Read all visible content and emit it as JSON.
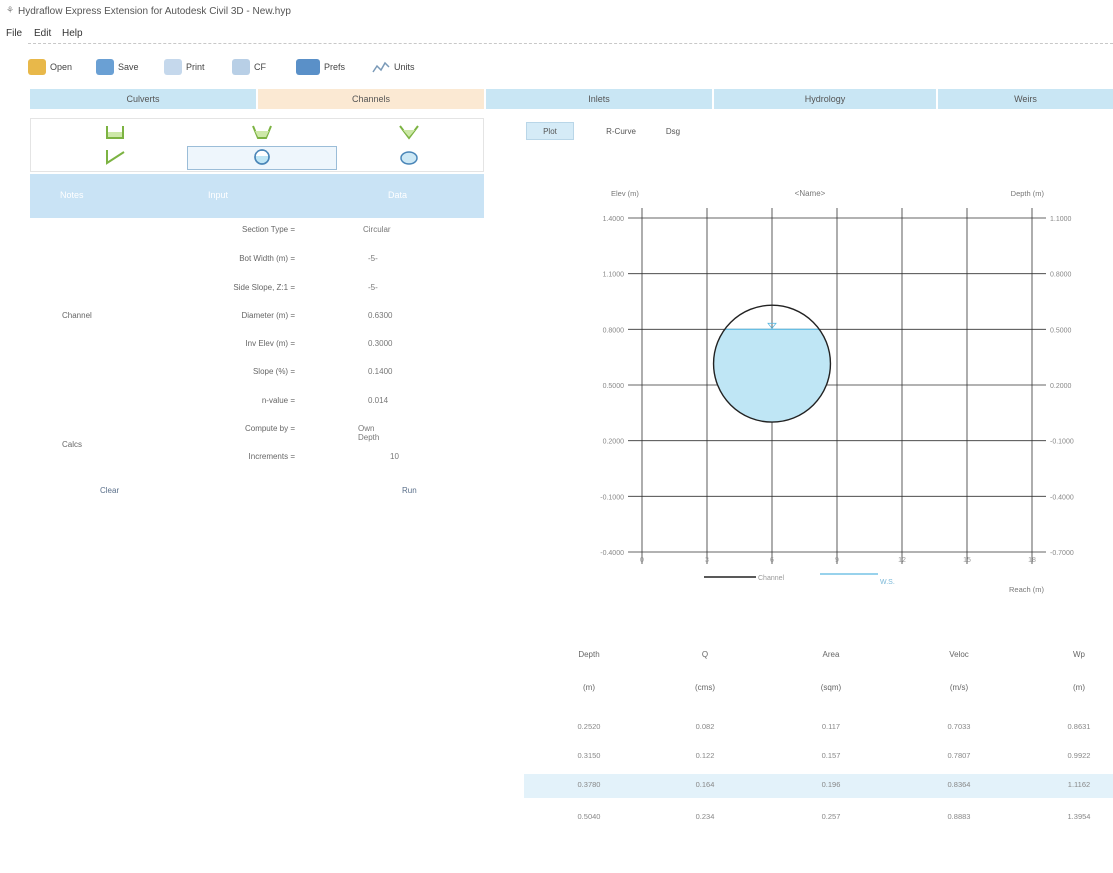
{
  "titlebar": {
    "app_icon": "hydraflow-icon",
    "title": "Hydraflow Express Extension for Autodesk Civil 3D - New.hyp"
  },
  "menu": {
    "items": [
      {
        "label": "File"
      },
      {
        "label": "Edit"
      },
      {
        "label": "Help"
      }
    ]
  },
  "toolbar": {
    "buttons": [
      {
        "label": "Open",
        "icon": "folder-icon",
        "color": "#e8b84a"
      },
      {
        "label": "Save",
        "icon": "save-icon",
        "color": "#6aa0d4"
      },
      {
        "label": "Print",
        "icon": "print-icon",
        "color": "#9ab8d8"
      },
      {
        "label": "CF",
        "icon": "copy-figure-icon",
        "color": "#8fb0d8"
      },
      {
        "label": "Prefs",
        "icon": "prefs-icon",
        "color": "#5a90c8"
      },
      {
        "label": "Units",
        "icon": "units-icon",
        "color": "#7a9ab8"
      }
    ]
  },
  "tabs": [
    {
      "label": "Culverts",
      "active": false
    },
    {
      "label": "Channels",
      "active": true
    },
    {
      "label": "Inlets",
      "active": false
    },
    {
      "label": "Hydrology",
      "active": false
    },
    {
      "label": "Weirs",
      "active": false
    }
  ],
  "channel_types": [
    {
      "icon": "rectangular-channel-icon"
    },
    {
      "icon": "trapezoidal-channel-icon"
    },
    {
      "icon": "triangular-channel-icon"
    },
    {
      "icon": "gutter-channel-icon"
    },
    {
      "icon": "circular-channel-icon",
      "selected": true
    },
    {
      "icon": "elliptical-channel-icon"
    }
  ],
  "left_header": {
    "col1": "Notes",
    "col2": "Input",
    "col3": "Data"
  },
  "inputs": {
    "rows": [
      {
        "label": "Section Type =",
        "value": "Circular"
      },
      {
        "label": "Bot Width (m) =",
        "value": "-5-"
      },
      {
        "label": "Side Slope, Z:1 =",
        "value": "-5-"
      },
      {
        "label": "Diameter (m) =",
        "value": "0.6300"
      },
      {
        "label": "Inv Elev (m) =",
        "value": "0.3000"
      },
      {
        "label": "Slope (%) =",
        "value": "0.1400"
      },
      {
        "label": "n-value =",
        "value": "0.014"
      },
      {
        "label": "Compute by =",
        "value": "Own Depth"
      },
      {
        "label": "Increments =",
        "value": "10"
      }
    ],
    "group_channel": "Channel",
    "group_calcs": "Calcs",
    "clear_label": "Clear",
    "run_label": "Run"
  },
  "right_tabs": [
    {
      "label": "Plot",
      "active": true
    },
    {
      "label": "R-Curve",
      "active": false
    },
    {
      "label": "Dsg",
      "active": false
    }
  ],
  "chart_data": {
    "type": "line",
    "title": "<Name>",
    "ylabel_left": "Elev (m)",
    "ylabel_right": "Depth (m)",
    "xlabel": "Reach (m)",
    "y_left_ticks": [
      "1.4000",
      "1.1000",
      "0.8000",
      "0.5000",
      "0.2000",
      "-0.1000",
      "-0.4000"
    ],
    "y_right_ticks": [
      "1.1000",
      "0.8000",
      "0.5000",
      "0.2000",
      "-0.1000",
      "-0.4000",
      "-0.7000"
    ],
    "x_ticks": [
      "0",
      "3",
      "6",
      "9",
      "12",
      "15",
      "18"
    ],
    "ylim": [
      -0.4,
      1.4
    ],
    "xlim": [
      0,
      18
    ],
    "grid": true,
    "legend": "bottom",
    "series": [
      {
        "name": "Channel",
        "color": "#222222",
        "shape": "circle",
        "center_x": 6,
        "center_y": 0.615,
        "diameter": 0.63
      },
      {
        "name": "W.S.",
        "color": "#5bb8e0",
        "water_elev": 0.8
      }
    ],
    "water_fill": "#bfe6f5"
  },
  "results": {
    "columns": [
      {
        "name": "Depth",
        "unit": "(m)"
      },
      {
        "name": "Q",
        "unit": "(cms)"
      },
      {
        "name": "Area",
        "unit": "(sqm)"
      },
      {
        "name": "Veloc",
        "unit": "(m/s)"
      },
      {
        "name": "Wp",
        "unit": "(m)"
      }
    ],
    "rows": [
      [
        "0.2520",
        "0.082",
        "0.117",
        "0.7033",
        "0.8631"
      ],
      [
        "0.3150",
        "0.122",
        "0.157",
        "0.7807",
        "0.9922"
      ],
      [
        "0.3780",
        "0.164",
        "0.196",
        "0.8364",
        "1.1162"
      ],
      [
        "0.5040",
        "0.234",
        "0.257",
        "0.8883",
        "1.3954"
      ]
    ]
  }
}
